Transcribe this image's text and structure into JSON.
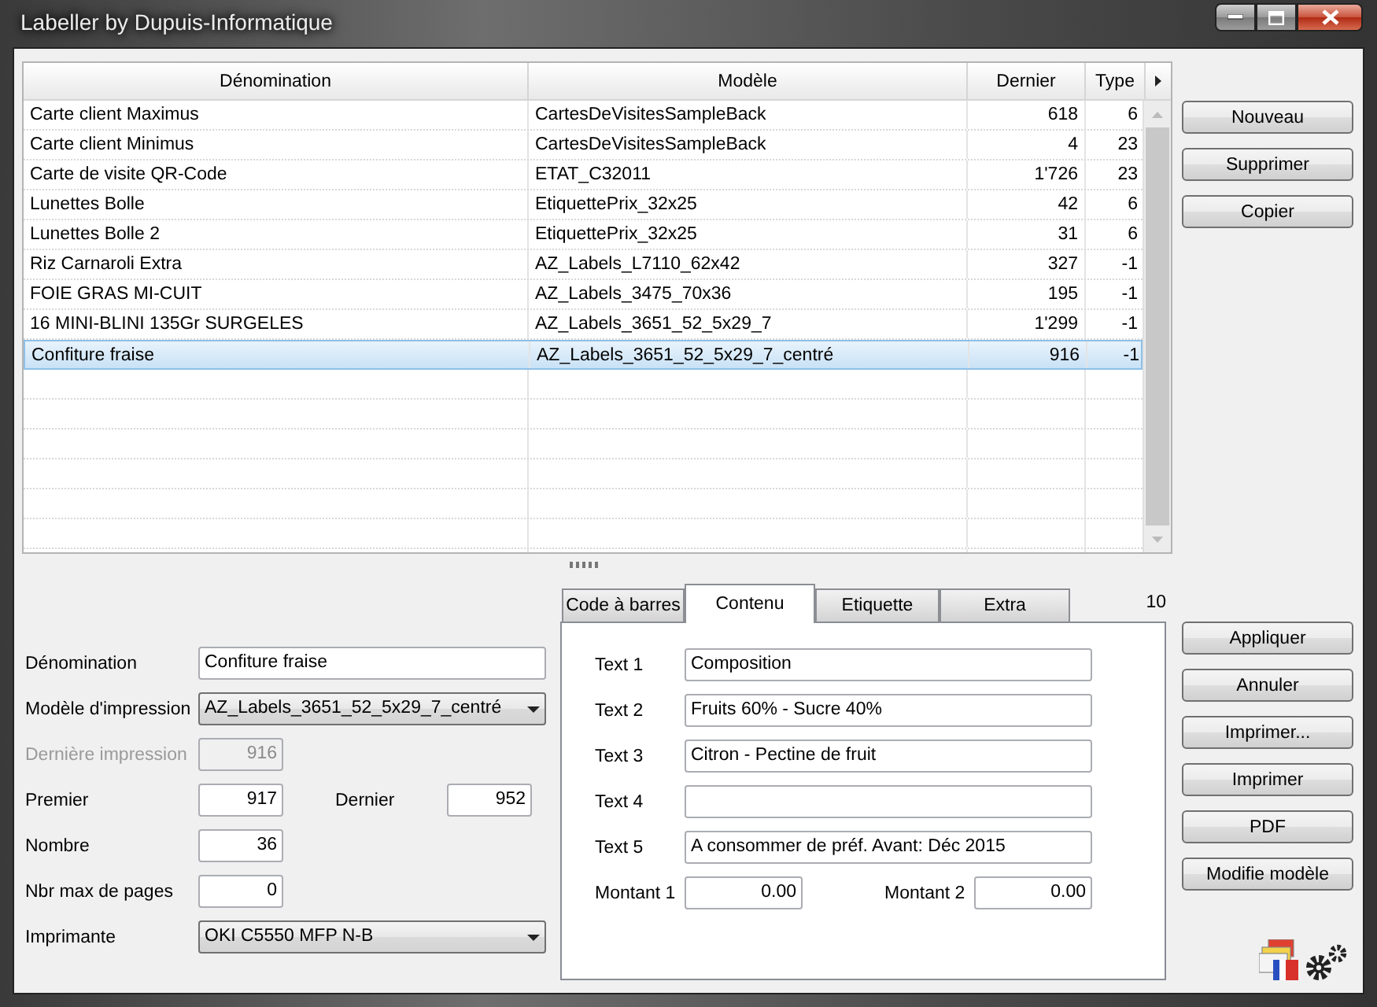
{
  "window": {
    "title": "Labeller by Dupuis-Informatique"
  },
  "table": {
    "columns": [
      "Dénomination",
      "Modèle",
      "Dernier",
      "Type"
    ],
    "rows": [
      {
        "cells": [
          "Carte client Maximus",
          "CartesDeVisitesSampleBack",
          "618",
          "6"
        ],
        "selected": false
      },
      {
        "cells": [
          "Carte client Minimus",
          "CartesDeVisitesSampleBack",
          "4",
          "23"
        ],
        "selected": false
      },
      {
        "cells": [
          "Carte de visite QR-Code",
          "ETAT_C32011",
          "1'726",
          "23"
        ],
        "selected": false
      },
      {
        "cells": [
          "Lunettes Bolle",
          "EtiquettePrix_32x25",
          "42",
          "6"
        ],
        "selected": false
      },
      {
        "cells": [
          "Lunettes Bolle 2",
          "EtiquettePrix_32x25",
          "31",
          "6"
        ],
        "selected": false
      },
      {
        "cells": [
          "Riz Carnaroli Extra",
          "AZ_Labels_L7110_62x42",
          "327",
          "-1"
        ],
        "selected": false
      },
      {
        "cells": [
          "FOIE GRAS MI-CUIT",
          "AZ_Labels_3475_70x36",
          "195",
          "-1"
        ],
        "selected": false
      },
      {
        "cells": [
          "16 MINI-BLINI 135Gr SURGELES",
          "AZ_Labels_3651_52_5x29_7",
          "1'299",
          "-1"
        ],
        "selected": false
      },
      {
        "cells": [
          "Confiture fraise",
          "AZ_Labels_3651_52_5x29_7_centré",
          "916",
          "-1"
        ],
        "selected": true
      }
    ]
  },
  "list_buttons": [
    "Nouveau",
    "Supprimer",
    "Copier"
  ],
  "form": {
    "rows": [
      {
        "fields": [
          {
            "label": "Dénomination",
            "value": "Confiture fraise",
            "kind": "text",
            "disabled": false
          }
        ]
      },
      {
        "fields": [
          {
            "label": "Modèle d'impression",
            "value": "AZ_Labels_3651_52_5x29_7_centré",
            "kind": "select",
            "disabled": false
          }
        ]
      },
      {
        "fields": [
          {
            "label": "Dernière impression",
            "value": "916",
            "kind": "number",
            "disabled": true
          }
        ]
      },
      {
        "fields": [
          {
            "label": "Premier",
            "value": "917",
            "kind": "number",
            "disabled": false
          },
          {
            "label": "Dernier",
            "value": "952",
            "kind": "number",
            "disabled": false
          }
        ]
      },
      {
        "fields": [
          {
            "label": "Nombre",
            "value": "36",
            "kind": "number",
            "disabled": false
          }
        ]
      },
      {
        "fields": [
          {
            "label": "Nbr max de pages",
            "value": "0",
            "kind": "number",
            "disabled": false
          }
        ]
      },
      {
        "fields": [
          {
            "label": "Imprimante",
            "value": "OKI C5550 MFP N-B",
            "kind": "select",
            "disabled": false
          }
        ]
      }
    ]
  },
  "tabs": [
    {
      "label": "Code à barres",
      "selected": false
    },
    {
      "label": "Contenu",
      "selected": true
    },
    {
      "label": "Etiquette",
      "selected": false
    },
    {
      "label": "Extra",
      "selected": false
    }
  ],
  "tab_count": "10",
  "content": {
    "fields": [
      {
        "label": "Text 1",
        "value": "Composition"
      },
      {
        "label": "Text 2",
        "value": "Fruits 60% - Sucre 40%"
      },
      {
        "label": "Text 3",
        "value": "Citron - Pectine de fruit"
      },
      {
        "label": "Text 4"
      },
      {
        "label": "Text 5",
        "value": "A consommer de préf. Avant: Déc 2015"
      }
    ],
    "amounts": [
      {
        "label": "Montant 1",
        "value": "0.00"
      },
      {
        "label": "Montant 2",
        "value": "0.00"
      }
    ]
  },
  "action_buttons": [
    "Appliquer",
    "Annuler",
    "Imprimer...",
    "Imprimer",
    "PDF",
    "Modifie modèle"
  ]
}
